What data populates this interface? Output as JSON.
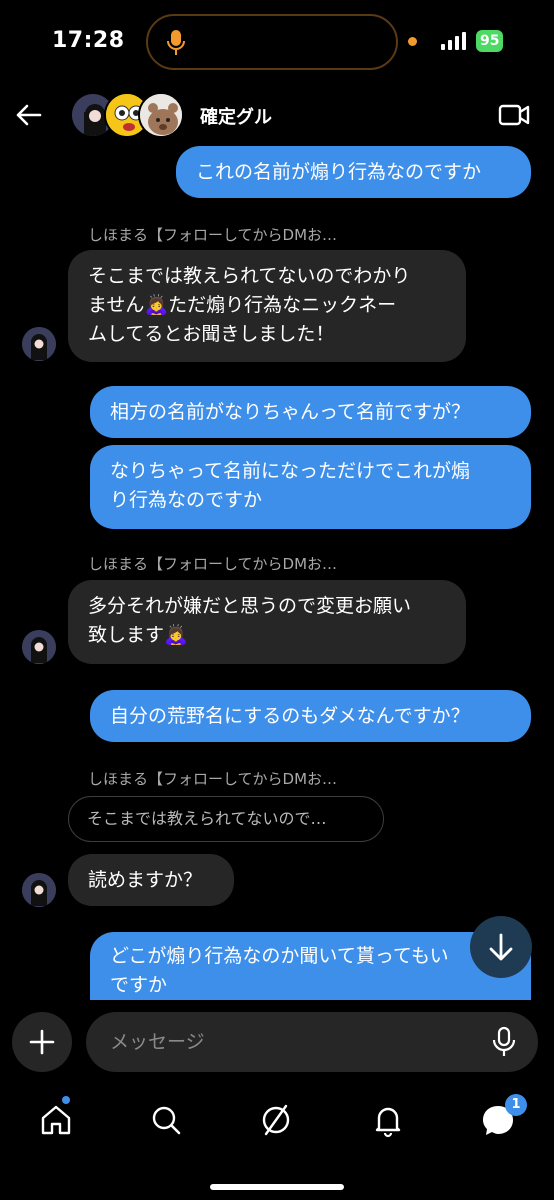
{
  "status_bar": {
    "time": "17:28",
    "battery": "95"
  },
  "header": {
    "group_name": "確定グル"
  },
  "messages": [
    {
      "type": "out",
      "text": "これの名前が煽り行為なのですか"
    },
    {
      "type": "sender",
      "text": "しほまる【フォローしてからDMお…"
    },
    {
      "type": "in",
      "line1": "そこまでは教えられてないのでわかり",
      "line2a": "ません",
      "line2b": "ただ煽り行為なニックネー",
      "line3": "ムしてるとお聞きしました！",
      "emoji": "🙇‍♀️"
    },
    {
      "type": "out",
      "text": "相方の名前がなりちゃんって名前ですが？"
    },
    {
      "type": "out",
      "line1": "なりちゃって名前になっただけでこれが煽",
      "line2": "り行為なのですか"
    },
    {
      "type": "sender",
      "text": "しほまる【フォローしてからDMお…"
    },
    {
      "type": "in",
      "line1": "多分それが嫌だと思うので変更お願い",
      "line2": "致します",
      "emoji": "🙇‍♀️"
    },
    {
      "type": "out",
      "text": "自分の荒野名にするのもダメなんですか？"
    },
    {
      "type": "sender",
      "text": "しほまる【フォローしてからDMお…"
    },
    {
      "type": "reply_quote",
      "text": "そこまでは教えられてないので…"
    },
    {
      "type": "in",
      "text": "読めますか？"
    },
    {
      "type": "out",
      "line1": "どこが煽り行為なのか聞いて貰ってもい",
      "line2": "ですか"
    }
  ],
  "composer": {
    "placeholder": "メッセージ"
  },
  "tabbar": {
    "messages_badge": "1"
  },
  "colors": {
    "outgoing": "#3e8fea",
    "incoming": "#262626",
    "background": "#000000"
  },
  "icons": [
    "back-arrow-icon",
    "video-call-icon",
    "plus-icon",
    "mic-icon",
    "home-icon",
    "search-icon",
    "explore-icon",
    "bell-icon",
    "messages-icon",
    "arrow-down-icon"
  ]
}
